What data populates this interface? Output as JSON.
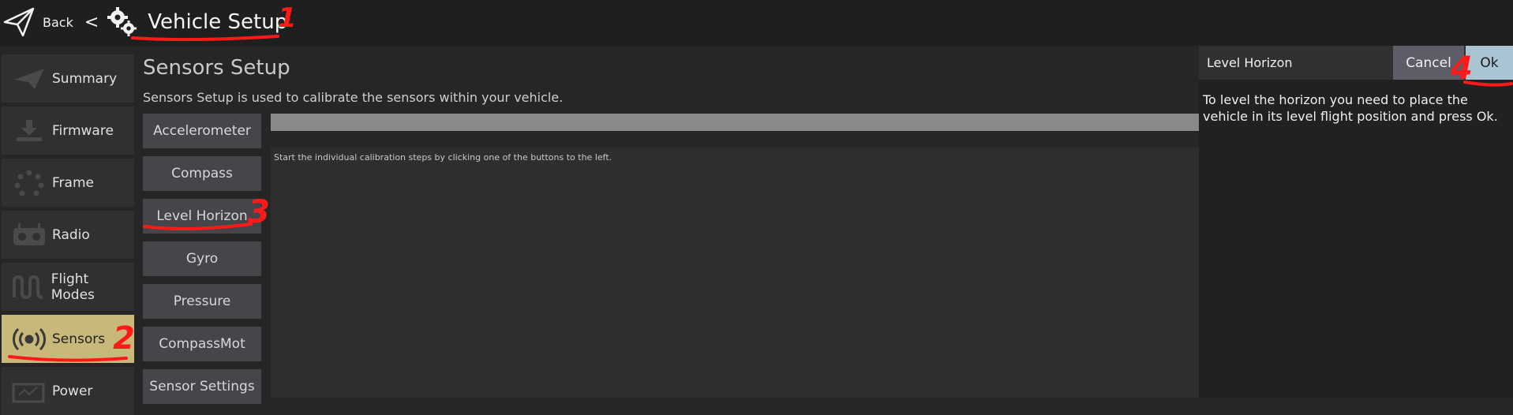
{
  "header": {
    "back_label": "Back",
    "separator": "<",
    "title": "Vehicle Setup",
    "icons": [
      "paper-plane-icon",
      "gears-icon"
    ]
  },
  "nav": {
    "items": [
      {
        "label": "Summary",
        "icon": "plane-icon"
      },
      {
        "label": "Firmware",
        "icon": "download-icon"
      },
      {
        "label": "Frame",
        "icon": "frame-icon"
      },
      {
        "label": "Radio",
        "icon": "radio-icon"
      },
      {
        "label": "Flight Modes",
        "icon": "wave-icon"
      },
      {
        "label": "Sensors",
        "icon": "sensors-icon",
        "active": true
      },
      {
        "label": "Power",
        "icon": "power-icon"
      }
    ]
  },
  "main": {
    "title": "Sensors Setup",
    "description": "Sensors Setup is used to calibrate the sensors within your vehicle.",
    "buttons": [
      "Accelerometer",
      "Compass",
      "Level Horizon",
      "Gyro",
      "Pressure",
      "CompassMot",
      "Sensor Settings"
    ],
    "status_text": "Start the individual calibration steps by clicking one of the buttons to the left."
  },
  "dialog": {
    "title": "Level Horizon",
    "cancel_label": "Cancel",
    "ok_label": "Ok",
    "body": "To level the horizon you need to place the vehicle in its level flight position and press Ok."
  },
  "annotations": {
    "marks": [
      "1",
      "2",
      "3",
      "4"
    ],
    "color": "#ff1a1a"
  },
  "colors": {
    "active_nav": "#c8b97a",
    "ok_button": "#a9c4d3",
    "cancel_button": "#5d5d68"
  }
}
